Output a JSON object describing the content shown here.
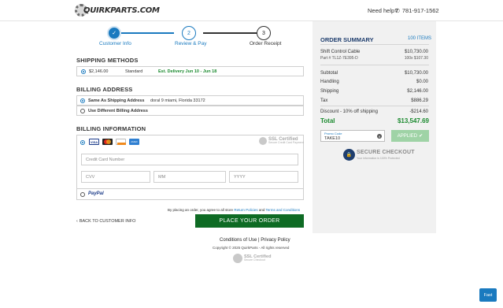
{
  "header": {
    "logo_text": "QUIRKPARTS.COM",
    "help_text": "Need help?",
    "phone": "781-917-1562"
  },
  "steps": [
    {
      "label": "Customer Info",
      "number": "✓",
      "state": "done"
    },
    {
      "label": "Review & Pay",
      "number": "2",
      "state": "active"
    },
    {
      "label": "Order Receipt",
      "number": "3",
      "state": "pending"
    }
  ],
  "shipping": {
    "title": "SHIPPING METHODS",
    "price": "$2,146.00",
    "method": "Standard",
    "delivery": "Est. Delivery Jun 10 - Jun 18"
  },
  "billing_address": {
    "title": "BILLING ADDRESS",
    "same_label": "Same As Shipping Address",
    "address": "doral 9 miami, Florida 33172",
    "different_label": "Use Different Billing Address"
  },
  "billing_info": {
    "title": "BILLING INFORMATION",
    "card_placeholder": "Credit Card Number",
    "cvv_placeholder": "CVV",
    "mm_placeholder": "MM",
    "yyyy_placeholder": "YYYY",
    "paypal": "PayPal",
    "ssl_title": "SSL Certified",
    "ssl_sub": "Secure Credit Card Payment"
  },
  "agreement": {
    "prefix": "By placing an order, you agree to all store",
    "returns": "Return Policies",
    "and": "and",
    "terms": "Terms and Conditions"
  },
  "actions": {
    "back": "BACK TO CUSTOMER INFO",
    "place_order": "PLACE YOUR ORDER"
  },
  "footer": {
    "terms": "Conditions of Use",
    "sep": "|",
    "privacy": "Privacy Policy",
    "copyright": "Copyright © 2025 QuirkParts - All rights reserved",
    "ssl_title": "SSL Certified",
    "ssl_sub": "Secure Checkout"
  },
  "summary": {
    "title": "ORDER SUMMARY",
    "items_link": "100 ITEMS",
    "product_name": "Shift Control Cable",
    "product_price": "$10,730.00",
    "part_number": "Part # TL1Z-7E395-D",
    "qty_line": "100x $107.30",
    "subtotal_label": "Subtotal",
    "subtotal": "$10,730.00",
    "handling_label": "Handling",
    "handling": "$0.00",
    "shipping_label": "Shipping",
    "shipping": "$2,146.00",
    "tax_label": "Tax",
    "tax": "$886.29",
    "discount_label": "Discount - 10% off shipping",
    "discount": "-$214.60",
    "total_label": "Total",
    "total": "$13,547.69",
    "promo_label": "Promo Code",
    "promo_value": "TAKE10",
    "applied": "APPLIED",
    "secure_title": "SECURE CHECKOUT",
    "secure_sub": "Your information is 100% Protected"
  },
  "fast_button": "Fast",
  "colors": {
    "accent": "#1a7abf",
    "green": "#1b8a2f",
    "place_order": "#0e6b24",
    "summary_title": "#1f3e6e"
  }
}
